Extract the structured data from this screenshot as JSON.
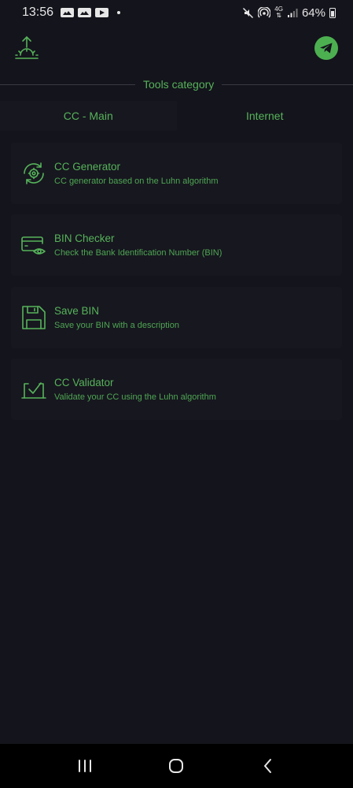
{
  "status_bar": {
    "time": "13:56",
    "notification_icons": [
      "gallery-icon",
      "gallery-icon",
      "youtube-icon"
    ],
    "right_icons": [
      "mute-icon",
      "hotspot-icon",
      "4g-icon",
      "signal-icon"
    ],
    "network": "4G",
    "battery": "64%"
  },
  "header": {
    "logo_icon": "sunrise-logo-icon",
    "telegram_icon": "telegram-icon"
  },
  "section": {
    "title": "Tools category"
  },
  "tabs": [
    {
      "label": "CC - Main",
      "active": true
    },
    {
      "label": "Internet",
      "active": false
    }
  ],
  "tools": [
    {
      "icon": "gear-refresh-icon",
      "title": "CC Generator",
      "description": "CC generator based on the Luhn algorithm"
    },
    {
      "icon": "card-eye-icon",
      "title": "BIN Checker",
      "description": "Check the Bank Identification Number (BIN)"
    },
    {
      "icon": "floppy-disk-icon",
      "title": "Save BIN",
      "description": "Save your BIN with a description"
    },
    {
      "icon": "check-box-icon",
      "title": "CC Validator",
      "description": "Validate your CC using the Luhn algorithm"
    }
  ],
  "nav_bar": {
    "items": [
      "recent-apps-icon",
      "home-icon",
      "back-icon"
    ]
  },
  "colors": {
    "background": "#14141c",
    "card": "#17171f",
    "accent": "#56b35a",
    "telegram": "#4cb050"
  }
}
